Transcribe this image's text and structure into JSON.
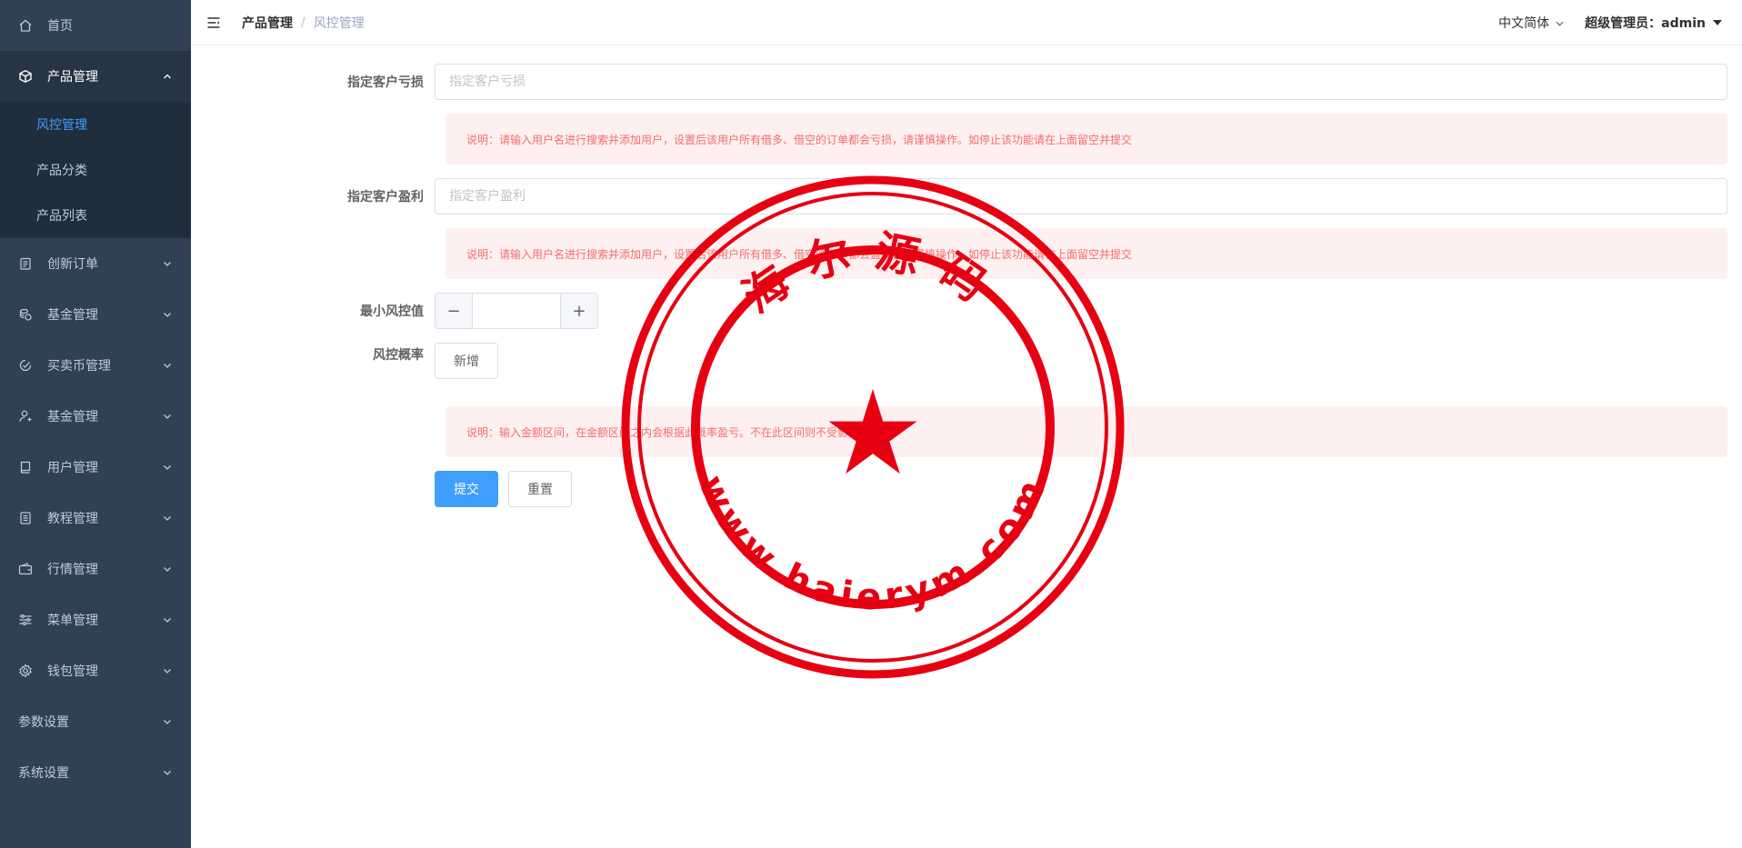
{
  "sidebar": {
    "items": [
      {
        "label": "首页",
        "icon": "home-icon"
      },
      {
        "label": "产品管理",
        "icon": "cube-icon"
      },
      {
        "label": "创新订单",
        "icon": "clipboard-icon"
      },
      {
        "label": "基金管理",
        "icon": "coins-icon"
      },
      {
        "label": "买卖币管理",
        "icon": "check-circle-icon"
      },
      {
        "label": "基金管理",
        "icon": "user-icon"
      },
      {
        "label": "用户管理",
        "icon": "book-icon"
      },
      {
        "label": "教程管理",
        "icon": "document-icon"
      },
      {
        "label": "行情管理",
        "icon": "wallet-icon"
      },
      {
        "label": "菜单管理",
        "icon": "sliders-icon"
      },
      {
        "label": "钱包管理",
        "icon": "gear-icon"
      },
      {
        "label": "参数设置",
        "icon": ""
      },
      {
        "label": "系统设置",
        "icon": ""
      }
    ],
    "submenu": [
      {
        "label": "风控管理"
      },
      {
        "label": "产品分类"
      },
      {
        "label": "产品列表"
      }
    ]
  },
  "header": {
    "breadcrumb": [
      "产品管理",
      "风控管理"
    ],
    "separator": "/",
    "language": "中文简体",
    "user": "超级管理员：admin"
  },
  "form": {
    "loss": {
      "label": "指定客户亏损",
      "placeholder": "指定客户亏损",
      "value": ""
    },
    "loss_note": "说明：请输入用户名进行搜索并添加用户，设置后该用户所有借多、借空的订单都会亏损，请谨慎操作。如停止该功能请在上面留空并提交",
    "profit": {
      "label": "指定客户盈利",
      "placeholder": "指定客户盈利",
      "value": ""
    },
    "profit_note": "说明：请输入用户名进行搜索并添加用户，设置后该用户所有借多、借空的订单都会盈利，请谨慎操作。如停止该功能请在上面留空并提交",
    "min_risk": {
      "label": "最小风控值",
      "minus": "−",
      "plus": "+",
      "value": ""
    },
    "risk_rate": {
      "label": "风控概率",
      "add_button": "新增"
    },
    "rate_note": "说明：输入金额区间，在金额区间之内会根据此概率盈亏。不在此区间则不受影响。",
    "submit": "提交",
    "reset": "重置"
  },
  "watermark": {
    "top_text": "海尔源码",
    "bottom_text": "www.haierym.com",
    "color": "#e60012"
  },
  "colors": {
    "sidebar_bg": "#304156",
    "submenu_bg": "#1f2d3d",
    "accent": "#409eff",
    "alert_bg": "#fef0f0",
    "alert_text": "#f56c6c"
  }
}
